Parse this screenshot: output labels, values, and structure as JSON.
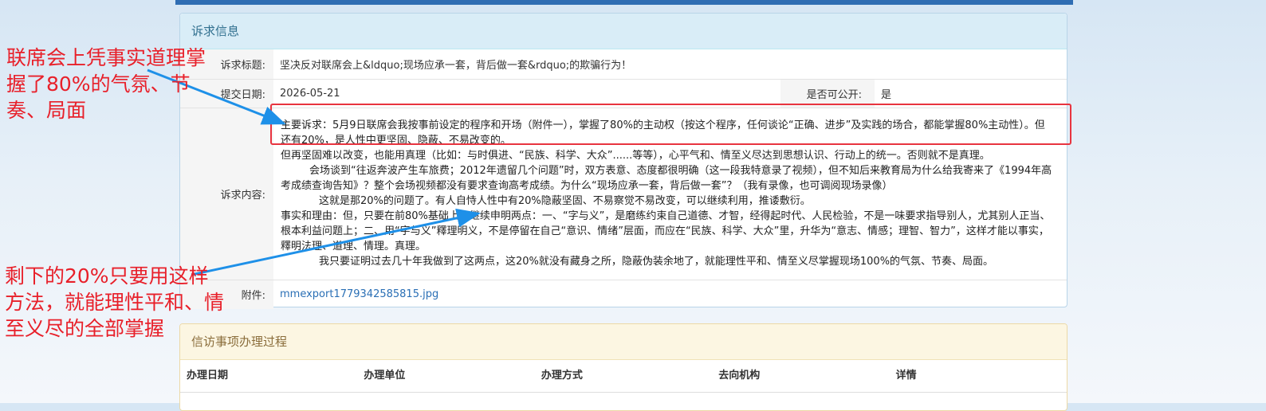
{
  "info_panel": {
    "title": "诉求信息",
    "subject_label": "诉求标题:",
    "subject_value": "坚决反对联席会上&ldquo;现场应承一套，背后做一套&rdquo;的欺骗行为！",
    "date_label": "提交日期:",
    "date_value": "2026-05-21",
    "public_label": "是否可公开:",
    "public_value": "是",
    "content_label": "诉求内容:",
    "content_paragraphs": [
      "主要诉求：5月9日联席会我按事前设定的程序和开场（附件一），掌握了80%的主动权（按这个程序，任何谈论“正确、进步”及实践的场合，都能掌握80%主动性）。但还有20%，是人性中更坚固、隐蔽、不易改变的。",
      "但再坚固难以改变，也能用真理（比如：与时俱进、“民族、科学、大众”......等等），心平气和、情至义尽达到思想认识、行动上的统一。否则就不是真理。",
      "会场谈到“往返奔波产生车旅费；2012年遗留几个问题”时，双方表意、态度都很明确（这一段我特意录了视频），但不知后来教育局为什么给我寄来了《1994年高考成绩查询告知》？整个会场视频都没有要求查询高考成绩。为什么“现场应承一套，背后做一套”？（我有录像，也可调阅现场录像）",
      "这就是那20%的问题了。有人自恃人性中有20%隐蔽坚固、不易察觉不易改变，可以继续利用，推诿敷衍。",
      "事实和理由：但，只要在前80%基础上，继续申明两点：一、“字与义”，是磨练约束自己道德、才智，经得起时代、人民检验，不是一味要求指导别人，尤其别人正当、根本利益问题上；二、用“字与义”釋理明义，不是停留在自己“意识、情绪”层面，而应在“民族、科学、大众”里，升华为“意志、情感；理智、智力”，这样才能以事实，釋明法理、道理、情理。真理。",
      "我只要证明过去几十年我做到了这两点，这20%就没有藏身之所，隐蔽伪装余地了，就能理性平和、情至义尽掌握现场100%的气氛、节奏、局面。"
    ],
    "attachment_label": "附件:",
    "attachment_value": "mmexport1779342585815.jpg"
  },
  "process_panel": {
    "title": "信访事项办理过程",
    "columns": [
      "办理日期",
      "办理单位",
      "办理方式",
      "去向机构",
      "详情"
    ]
  },
  "annotations": {
    "top_note": "联席会上凭事实道理掌握了80%的气氛、节奏、局面",
    "bottom_note": "剩下的20%只要用这样方法，就能理性平和、情至义尽的全部掌握"
  },
  "colors": {
    "annotation_red": "#e8202a",
    "arrow_blue": "#1e90e8",
    "header_blue": "#2f6db3"
  }
}
